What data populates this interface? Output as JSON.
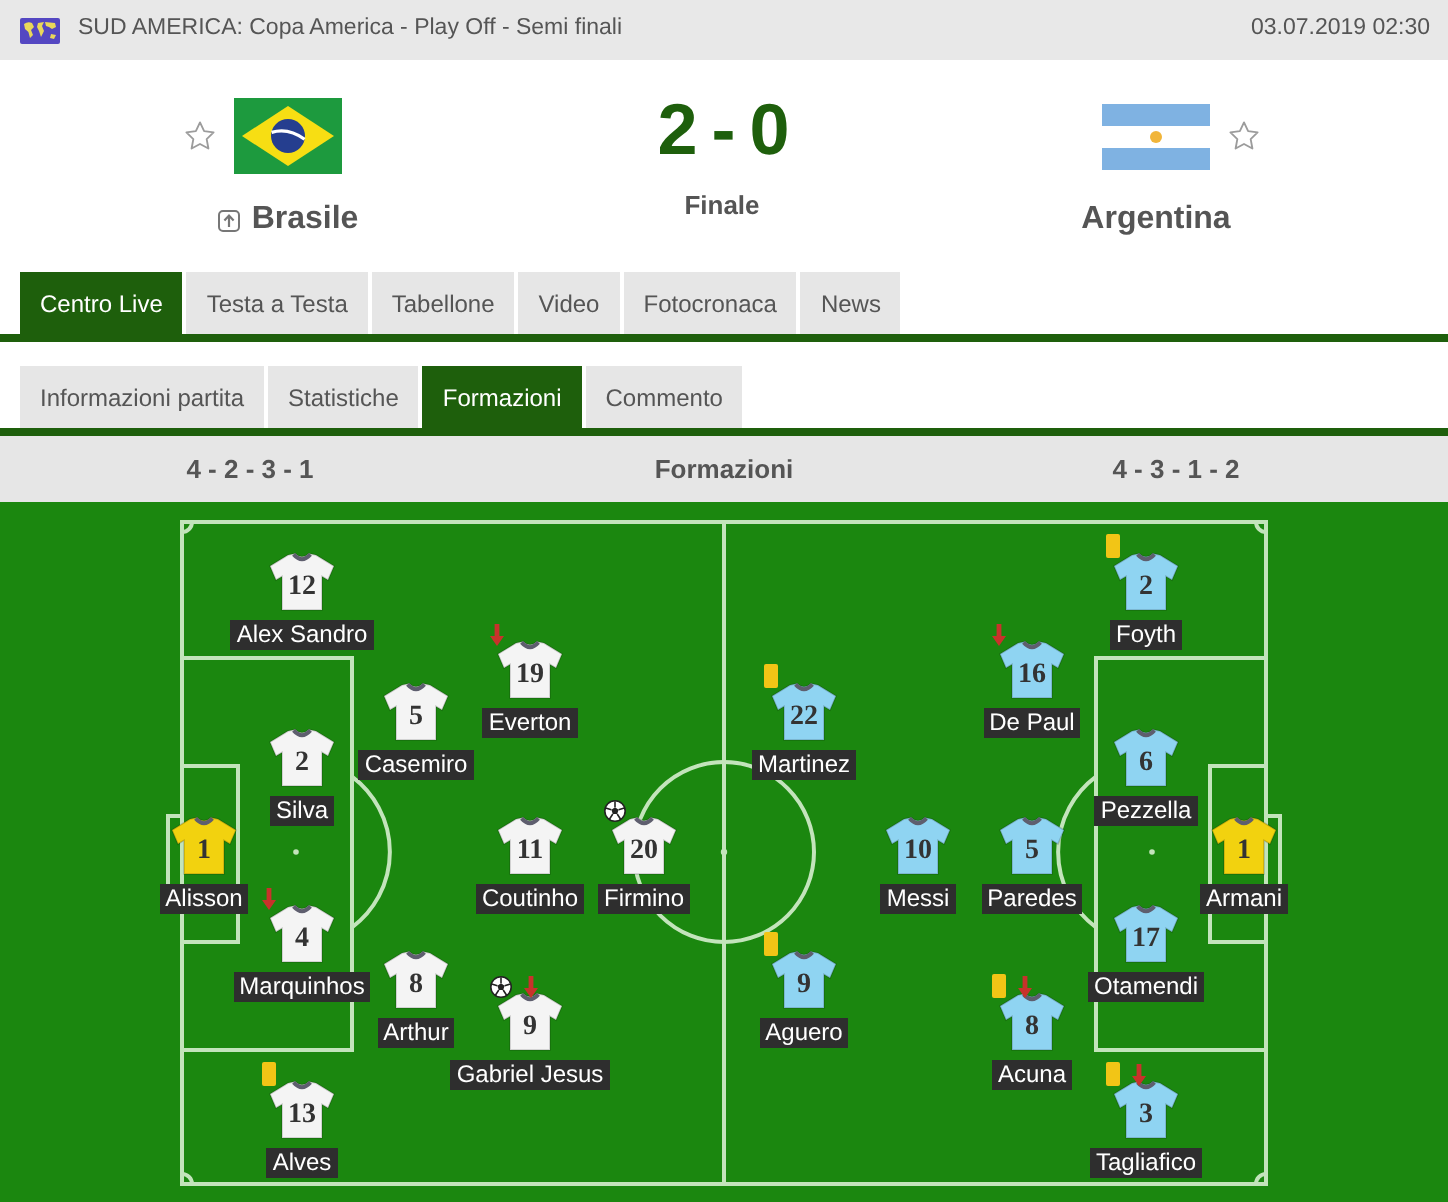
{
  "header": {
    "competition": "SUD AMERICA: Copa America - Play Off - Semi finali",
    "datetime": "03.07.2019 02:30"
  },
  "match": {
    "home": {
      "name": "Brasile",
      "starred": false,
      "advanced": true
    },
    "score": "2 - 0",
    "status": "Finale",
    "away": {
      "name": "Argentina",
      "starred": false,
      "advanced": false
    }
  },
  "tabs": [
    {
      "label": "Centro Live",
      "selected": true
    },
    {
      "label": "Testa a Testa",
      "selected": false
    },
    {
      "label": "Tabellone",
      "selected": false
    },
    {
      "label": "Video",
      "selected": false
    },
    {
      "label": "Fotocronaca",
      "selected": false
    },
    {
      "label": "News",
      "selected": false
    }
  ],
  "subtabs": [
    {
      "label": "Informazioni partita",
      "selected": false
    },
    {
      "label": "Statistiche",
      "selected": false
    },
    {
      "label": "Formazioni",
      "selected": true
    },
    {
      "label": "Commento",
      "selected": false
    }
  ],
  "lineups_bar": {
    "home_formation": "4 - 2 - 3 - 1",
    "title": "Formazioni",
    "away_formation": "4 - 3 - 1 - 2"
  },
  "teams": [
    {
      "lines": [
        {
          "players": [
            {
              "number": "1",
              "name": "Alisson",
              "color": "#f2d20f",
              "yellow_card": false,
              "goal": false,
              "subbed_off": false
            }
          ]
        },
        {
          "players": [
            {
              "number": "12",
              "name": "Alex Sandro",
              "color": "#f4f4f4",
              "yellow_card": false,
              "goal": false,
              "subbed_off": false
            },
            {
              "number": "2",
              "name": "Silva",
              "color": "#f4f4f4",
              "yellow_card": false,
              "goal": false,
              "subbed_off": false
            },
            {
              "number": "4",
              "name": "Marquinhos",
              "color": "#f4f4f4",
              "yellow_card": false,
              "goal": false,
              "subbed_off": true
            },
            {
              "number": "13",
              "name": "Alves",
              "color": "#f4f4f4",
              "yellow_card": true,
              "goal": false,
              "subbed_off": false
            }
          ]
        },
        {
          "players": [
            {
              "number": "5",
              "name": "Casemiro",
              "color": "#f4f4f4",
              "yellow_card": false,
              "goal": false,
              "subbed_off": false
            },
            {
              "number": "8",
              "name": "Arthur",
              "color": "#f4f4f4",
              "yellow_card": false,
              "goal": false,
              "subbed_off": false
            }
          ]
        },
        {
          "players": [
            {
              "number": "19",
              "name": "Everton",
              "color": "#f4f4f4",
              "yellow_card": false,
              "goal": false,
              "subbed_off": true
            },
            {
              "number": "11",
              "name": "Coutinho",
              "color": "#f4f4f4",
              "yellow_card": false,
              "goal": false,
              "subbed_off": false
            },
            {
              "number": "9",
              "name": "Gabriel Jesus",
              "color": "#f4f4f4",
              "yellow_card": false,
              "goal": true,
              "subbed_off": true
            }
          ]
        },
        {
          "players": [
            {
              "number": "20",
              "name": "Firmino",
              "color": "#f4f4f4",
              "yellow_card": false,
              "goal": true,
              "subbed_off": false
            }
          ]
        }
      ]
    },
    {
      "lines": [
        {
          "players": [
            {
              "number": "22",
              "name": "Martinez",
              "color": "#8fd4f2",
              "yellow_card": true,
              "goal": false,
              "subbed_off": false
            },
            {
              "number": "9",
              "name": "Aguero",
              "color": "#8fd4f2",
              "yellow_card": true,
              "goal": false,
              "subbed_off": false
            }
          ]
        },
        {
          "players": [
            {
              "number": "10",
              "name": "Messi",
              "color": "#8fd4f2",
              "yellow_card": false,
              "goal": false,
              "subbed_off": false
            }
          ]
        },
        {
          "players": [
            {
              "number": "16",
              "name": "De Paul",
              "color": "#8fd4f2",
              "yellow_card": false,
              "goal": false,
              "subbed_off": true
            },
            {
              "number": "5",
              "name": "Paredes",
              "color": "#8fd4f2",
              "yellow_card": false,
              "goal": false,
              "subbed_off": false
            },
            {
              "number": "8",
              "name": "Acuna",
              "color": "#8fd4f2",
              "yellow_card": true,
              "goal": false,
              "subbed_off": true
            }
          ]
        },
        {
          "players": [
            {
              "number": "2",
              "name": "Foyth",
              "color": "#8fd4f2",
              "yellow_card": true,
              "goal": false,
              "subbed_off": false
            },
            {
              "number": "6",
              "name": "Pezzella",
              "color": "#8fd4f2",
              "yellow_card": false,
              "goal": false,
              "subbed_off": false
            },
            {
              "number": "17",
              "name": "Otamendi",
              "color": "#8fd4f2",
              "yellow_card": false,
              "goal": false,
              "subbed_off": false
            },
            {
              "number": "3",
              "name": "Tagliafico",
              "color": "#8fd4f2",
              "yellow_card": true,
              "goal": false,
              "subbed_off": true
            }
          ]
        },
        {
          "players": [
            {
              "number": "1",
              "name": "Armani",
              "color": "#f2d20f",
              "yellow_card": false,
              "goal": false,
              "subbed_off": false
            }
          ]
        }
      ]
    }
  ]
}
